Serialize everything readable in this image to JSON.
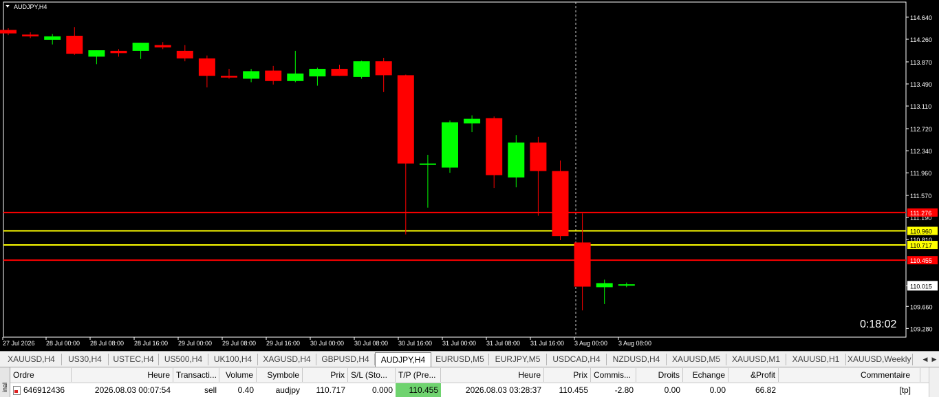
{
  "chart": {
    "title": "AUDJPY,H4",
    "timer": "0:18:02",
    "colors": {
      "bg": "#000000",
      "bull": "#00ff00",
      "bear": "#ff0000",
      "axis": "#ffffff",
      "sl_line": "#ff0000",
      "entry_line": "#ffff00"
    },
    "price_ticks": [
      "114.640",
      "114.260",
      "113.870",
      "113.490",
      "113.110",
      "112.720",
      "112.340",
      "111.960",
      "111.570",
      "111.190",
      "110.810",
      "110.015",
      "109.660",
      "109.280"
    ],
    "time_labels": [
      "27 Jul 2026",
      "28 Jul 00:00",
      "28 Jul 08:00",
      "28 Jul 16:00",
      "29 Jul 00:00",
      "29 Jul 08:00",
      "29 Jul 16:00",
      "30 Jul 00:00",
      "30 Jul 08:00",
      "30 Jul 16:00",
      "31 Jul 00:00",
      "31 Jul 08:00",
      "31 Jul 16:00",
      "3 Aug 00:00",
      "3 Aug 08:00"
    ],
    "hlines": [
      {
        "price": 111.276,
        "label": "111.276",
        "color": "#ff0000"
      },
      {
        "price": 110.96,
        "label": "110.960",
        "color": "#ffff00"
      },
      {
        "price": 110.717,
        "label": "110.717",
        "color": "#ffff00"
      },
      {
        "price": 110.455,
        "label": "110.455",
        "color": "#ff0000"
      }
    ],
    "current_price": "110.015",
    "candles": [
      {
        "o": 114.42,
        "h": 114.45,
        "l": 114.33,
        "c": 114.36
      },
      {
        "o": 114.34,
        "h": 114.38,
        "l": 114.28,
        "c": 114.31
      },
      {
        "o": 114.25,
        "h": 114.35,
        "l": 114.17,
        "c": 114.31
      },
      {
        "o": 114.32,
        "h": 114.47,
        "l": 113.99,
        "c": 114.01
      },
      {
        "o": 113.96,
        "h": 114.07,
        "l": 113.83,
        "c": 114.07
      },
      {
        "o": 114.06,
        "h": 114.09,
        "l": 113.96,
        "c": 114.02
      },
      {
        "o": 114.06,
        "h": 114.2,
        "l": 113.92,
        "c": 114.2
      },
      {
        "o": 114.16,
        "h": 114.21,
        "l": 114.09,
        "c": 114.12
      },
      {
        "o": 114.06,
        "h": 114.16,
        "l": 113.88,
        "c": 113.93
      },
      {
        "o": 113.93,
        "h": 113.98,
        "l": 113.43,
        "c": 113.63
      },
      {
        "o": 113.63,
        "h": 113.75,
        "l": 113.58,
        "c": 113.6
      },
      {
        "o": 113.58,
        "h": 113.75,
        "l": 113.52,
        "c": 113.71
      },
      {
        "o": 113.72,
        "h": 113.8,
        "l": 113.48,
        "c": 113.54
      },
      {
        "o": 113.54,
        "h": 114.06,
        "l": 113.52,
        "c": 113.67
      },
      {
        "o": 113.62,
        "h": 113.77,
        "l": 113.46,
        "c": 113.75
      },
      {
        "o": 113.75,
        "h": 113.82,
        "l": 113.63,
        "c": 113.63
      },
      {
        "o": 113.61,
        "h": 113.89,
        "l": 113.58,
        "c": 113.88
      },
      {
        "o": 113.88,
        "h": 113.94,
        "l": 113.35,
        "c": 113.64
      },
      {
        "o": 113.64,
        "h": 113.65,
        "l": 110.9,
        "c": 112.12
      },
      {
        "o": 112.1,
        "h": 112.27,
        "l": 111.36,
        "c": 112.12
      },
      {
        "o": 112.05,
        "h": 112.86,
        "l": 111.96,
        "c": 112.83
      },
      {
        "o": 112.81,
        "h": 112.95,
        "l": 112.66,
        "c": 112.89
      },
      {
        "o": 112.9,
        "h": 112.93,
        "l": 111.7,
        "c": 111.92
      },
      {
        "o": 111.88,
        "h": 112.61,
        "l": 111.71,
        "c": 112.48
      },
      {
        "o": 112.48,
        "h": 112.58,
        "l": 111.22,
        "c": 111.99
      },
      {
        "o": 111.99,
        "h": 112.17,
        "l": 110.8,
        "c": 110.87
      },
      {
        "o": 110.76,
        "h": 111.26,
        "l": 109.59,
        "c": 110.0
      },
      {
        "o": 109.99,
        "h": 110.12,
        "l": 109.7,
        "c": 110.06
      },
      {
        "o": 110.02,
        "h": 110.07,
        "l": 109.99,
        "c": 110.04
      }
    ]
  },
  "tabs": [
    {
      "label": "XAUUSD,H4",
      "active": false
    },
    {
      "label": "US30,H4",
      "active": false
    },
    {
      "label": "USTEC,H4",
      "active": false
    },
    {
      "label": "US500,H4",
      "active": false
    },
    {
      "label": "UK100,H4",
      "active": false
    },
    {
      "label": "XAGUSD,H4",
      "active": false
    },
    {
      "label": "GBPUSD,H4",
      "active": false
    },
    {
      "label": "AUDJPY,H4",
      "active": true
    },
    {
      "label": "EURUSD,M5",
      "active": false
    },
    {
      "label": "EURJPY,M5",
      "active": false
    },
    {
      "label": "USDCAD,H4",
      "active": false
    },
    {
      "label": "NZDUSD,H4",
      "active": false
    },
    {
      "label": "XAUUSD,M5",
      "active": false
    },
    {
      "label": "XAUUSD,M1",
      "active": false
    },
    {
      "label": "XAUUSD,H1",
      "active": false
    },
    {
      "label": "XAUUSD,Weekly",
      "active": false
    }
  ],
  "terminal": {
    "sidebar_label": "inal",
    "headers": {
      "ordre": "Ordre",
      "heure": "Heure",
      "transaction": "Transacti...",
      "volume": "Volume",
      "symbole": "Symbole",
      "prix": "Prix",
      "sl": "S/L (Sto...",
      "tp": "T/P (Pre...",
      "heure2": "Heure",
      "prix2": "Prix",
      "commission": "Commis...",
      "droits": "Droits",
      "echange": "Echange",
      "profit": "&Profit",
      "commentaire": "Commentaire"
    },
    "row": {
      "ordre": "646912436",
      "heure": "2026.08.03 00:07:54",
      "transaction": "sell",
      "volume": "0.40",
      "symbole": "audjpy",
      "prix": "110.717",
      "sl": "0.000",
      "tp": "110.455",
      "heure2": "2026.08.03 03:28:37",
      "prix2": "110.455",
      "commission": "-2.80",
      "droits": "0.00",
      "echange": "0.00",
      "profit": "66.82",
      "commentaire": "[tp]"
    }
  }
}
